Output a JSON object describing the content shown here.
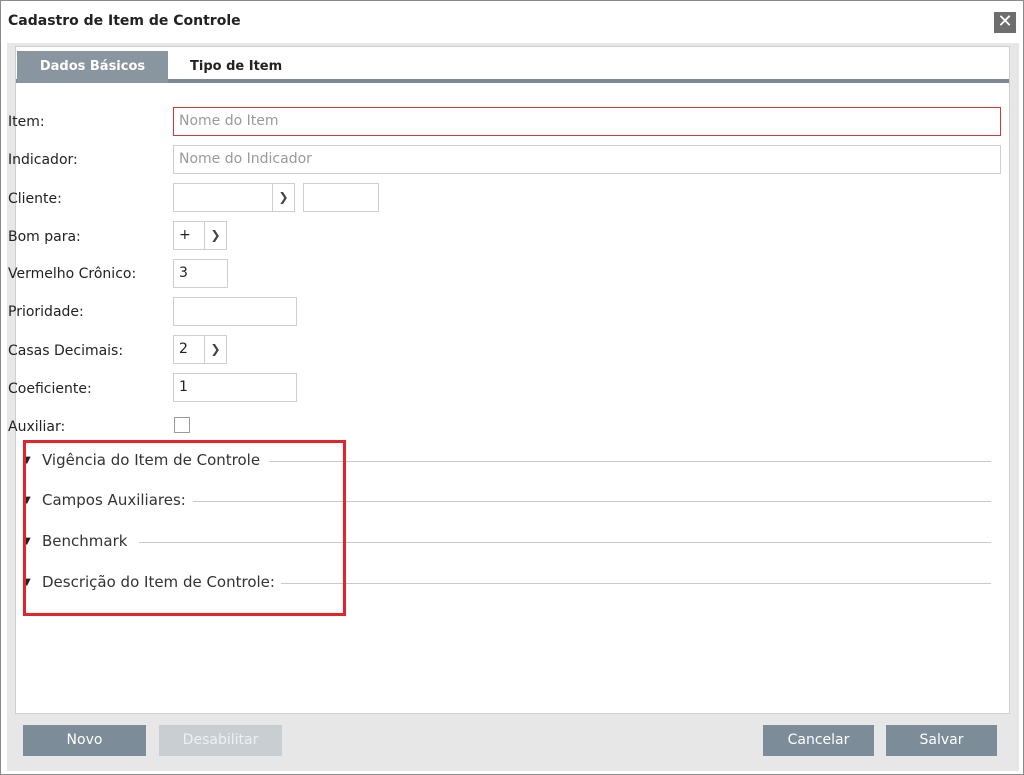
{
  "window": {
    "title": "Cadastro de Item de Controle",
    "close_glyph": "✕"
  },
  "tabs": [
    {
      "label": "Dados Básicos",
      "active": true
    },
    {
      "label": "Tipo de Item",
      "active": false
    }
  ],
  "form": {
    "item": {
      "label": "Item:",
      "placeholder": "Nome do Item",
      "value": ""
    },
    "indicador": {
      "label": "Indicador:",
      "placeholder": "Nome do Indicador",
      "value": ""
    },
    "cliente": {
      "label": "Cliente:",
      "value": "",
      "code": ""
    },
    "bom_para": {
      "label": "Bom para:",
      "value": "+"
    },
    "vermelho_cronico": {
      "label": "Vermelho Crônico:",
      "value": "3"
    },
    "prioridade": {
      "label": "Prioridade:",
      "value": ""
    },
    "casas_decimais": {
      "label": "Casas Decimais:",
      "value": "2"
    },
    "coeficiente": {
      "label": "Coeficiente:",
      "value": "1"
    },
    "auxiliar": {
      "label": "Auxiliar:",
      "checked": false
    }
  },
  "sections": [
    {
      "label": "Vigência do Item de Controle"
    },
    {
      "label": "Campos Auxiliares:"
    },
    {
      "label": "Benchmark"
    },
    {
      "label": "Descrição do Item de Controle:"
    }
  ],
  "footer": {
    "novo": "Novo",
    "desabilitar": "Desabilitar",
    "cancelar": "Cancelar",
    "salvar": "Salvar"
  },
  "colors": {
    "tab_active_bg": "#8a969f",
    "primary_button": "#7c8c98",
    "invalid_border": "#d23838",
    "highlight": "#e5232a"
  },
  "icons": {
    "close": "close-icon",
    "dropdown": "chevron-down-icon",
    "section_toggle": "caret-down-icon"
  }
}
